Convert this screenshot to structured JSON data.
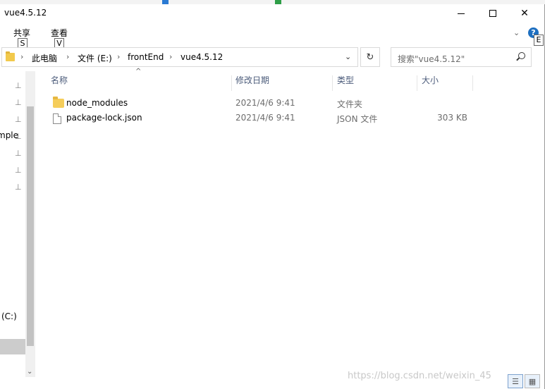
{
  "window": {
    "title": "vue4.5.12",
    "minimize_glyph": "",
    "close_glyph": "✕"
  },
  "ribbon": {
    "tabs": [
      {
        "label": "共享",
        "keytip": "S"
      },
      {
        "label": "查看",
        "keytip": "V"
      }
    ],
    "help_keytip": "E",
    "help_glyph": "?",
    "collapse_glyph": "⌄"
  },
  "address": {
    "crumbs": [
      "此电脑",
      "文件 (E:)",
      "frontEnd",
      "vue4.5.12"
    ],
    "separator": "›",
    "dropdown_glyph": "⌄",
    "refresh_glyph": "↻"
  },
  "search": {
    "placeholder": "搜索\"vue4.5.12\""
  },
  "nav": {
    "fragments": [
      "mple",
      "(C:)"
    ],
    "pin_glyph": "📌"
  },
  "columns": {
    "name": "名称",
    "date": "修改日期",
    "type": "类型",
    "size": "大小"
  },
  "files": [
    {
      "name": "node_modules",
      "date": "2021/4/6 9:41",
      "type": "文件夹",
      "size": "",
      "icon": "folder-icon"
    },
    {
      "name": "package-lock.json",
      "date": "2021/4/6 9:41",
      "type": "JSON 文件",
      "size": "303 KB",
      "icon": "file-icon"
    }
  ],
  "watermark": "https://blog.csdn.net/weixin_45",
  "colors": {
    "folder": "#f5cd5a",
    "header_text": "#4b5b7a",
    "help_blue": "#1e6fc0"
  }
}
